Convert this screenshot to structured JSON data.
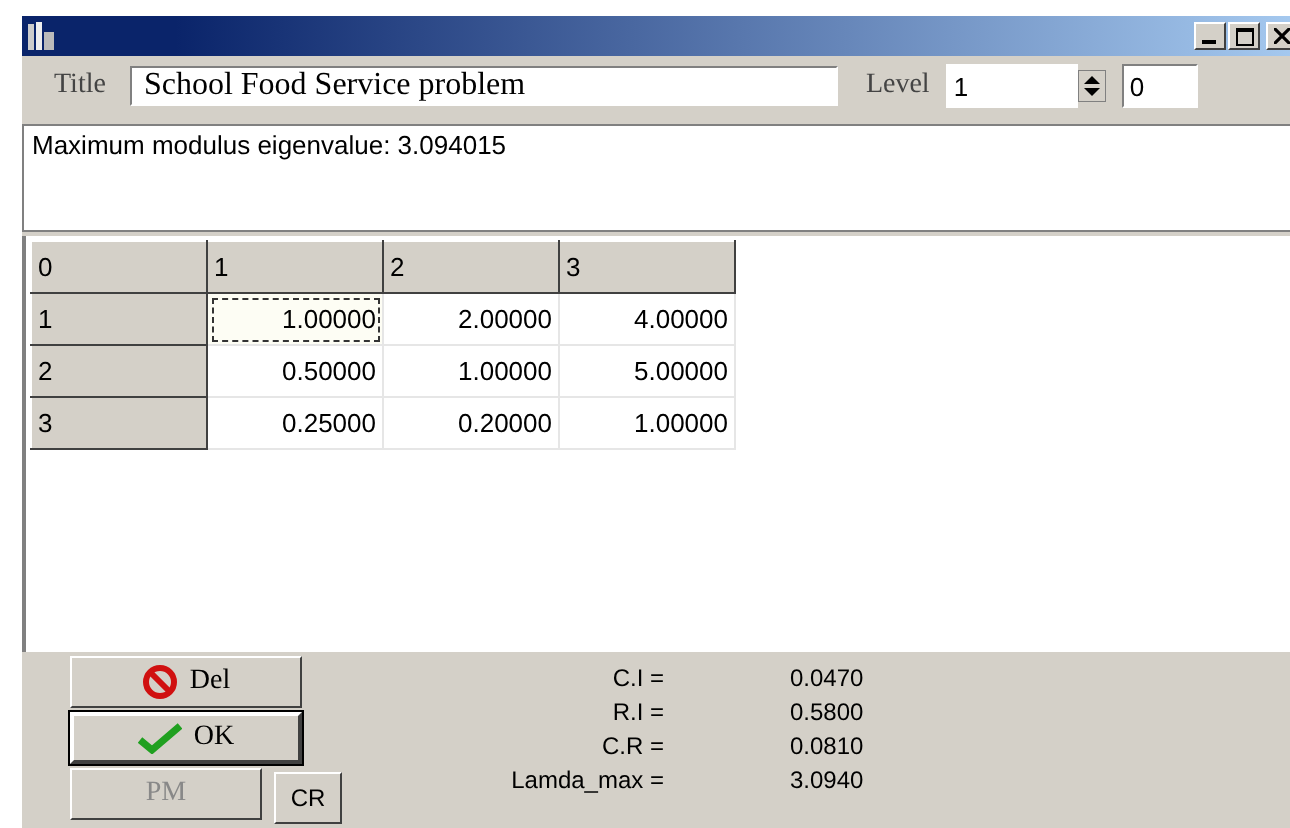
{
  "title_field": {
    "label": "Title",
    "value": "School Food Service problem"
  },
  "level_field": {
    "label": "Level",
    "value": "1"
  },
  "extra_field": {
    "value": "0"
  },
  "message": "Maximum modulus eigenvalue: 3.094015",
  "grid": {
    "corner": "0",
    "columns": [
      "1",
      "2",
      "3"
    ],
    "rows": [
      {
        "header": "1",
        "cells": [
          {
            "value": "1.00000",
            "selected": true
          },
          {
            "value": "2.00000",
            "selected": false
          },
          {
            "value": "4.00000",
            "selected": false
          }
        ]
      },
      {
        "header": "2",
        "cells": [
          {
            "value": "0.50000",
            "selected": false
          },
          {
            "value": "1.00000",
            "selected": false
          },
          {
            "value": "5.00000",
            "selected": false
          }
        ]
      },
      {
        "header": "3",
        "cells": [
          {
            "value": "0.25000",
            "selected": false
          },
          {
            "value": "0.20000",
            "selected": false
          },
          {
            "value": "1.00000",
            "selected": false
          }
        ]
      }
    ]
  },
  "buttons": [
    {
      "label": "Del",
      "kind": "delete",
      "disabled": false,
      "default": false
    },
    {
      "label": "OK",
      "kind": "ok",
      "disabled": false,
      "default": true
    },
    {
      "label": "PM",
      "kind": "plain",
      "disabled": true,
      "default": false
    },
    {
      "label": "CR",
      "kind": "small",
      "disabled": false,
      "default": false
    }
  ],
  "results": [
    {
      "label": "C.I =",
      "value": "0.0470"
    },
    {
      "label": "R.I =",
      "value": "0.5800"
    },
    {
      "label": "C.R =",
      "value": "0.0810"
    },
    {
      "label": "Lamda_max =",
      "value": "3.0940"
    }
  ]
}
